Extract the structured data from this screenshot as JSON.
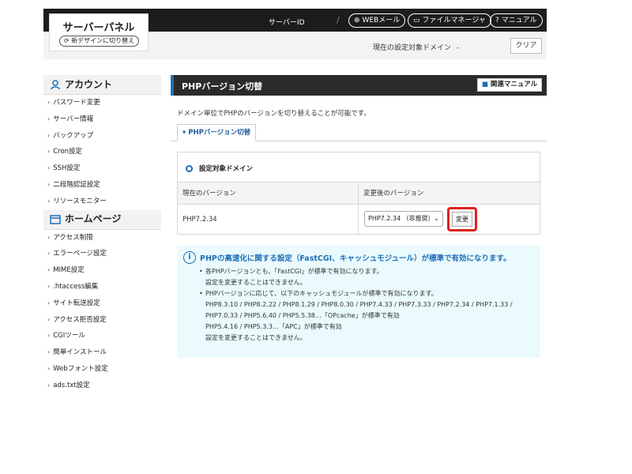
{
  "header": {
    "logo_title": "サーバーパネル",
    "new_design_label": "新デザインに切り替え",
    "server_id_label": "サーバーID",
    "separator": "/",
    "links": [
      {
        "icon": "globe-icon",
        "label": "WEBメール"
      },
      {
        "icon": "folder-icon",
        "label": "ファイルマネージャ"
      },
      {
        "icon": "question-icon",
        "label": "マニュアル"
      }
    ],
    "target_domain_label": "現在の設定対象ドメイン",
    "target_domain_value": "-",
    "clear_label": "クリア"
  },
  "sidebar": {
    "sections": [
      {
        "title": "アカウント",
        "icon": "user-icon",
        "items": [
          "パスワード変更",
          "サーバー情報",
          "バックアップ",
          "Cron設定",
          "SSH設定",
          "二段階認証設定",
          "リソースモニター"
        ]
      },
      {
        "title": "ホームページ",
        "icon": "window-icon",
        "items": [
          "アクセス制限",
          "エラーページ設定",
          "MIME設定",
          ".htaccess編集",
          "サイト転送設定",
          "アクセス拒否設定",
          "CGIツール",
          "簡単インストール",
          "Webフォント設定",
          "ads.txt設定"
        ]
      }
    ]
  },
  "main": {
    "title": "PHPバージョン切替",
    "manual_label": "関連マニュアル",
    "description": "ドメイン単位でPHPのバージョンを切り替えることが可能です。",
    "tab_label": "PHPバージョン切替",
    "panel_title": "設定対象ドメイン",
    "table": {
      "headers": [
        "現在のバージョン",
        "変更後のバージョン"
      ],
      "current_version": "PHP7.2.34",
      "selected_version": "PHP7.2.34 （非推奨）",
      "change_label": "変更"
    },
    "info": {
      "title": "PHPの高速化に関する設定（FastCGI、キャッシュモジュール）が標準で有効になります。",
      "lines": [
        {
          "bullet": "•",
          "text": "各PHPバージョンとも、「FastCGI」が標準で有効になります。"
        },
        {
          "bullet": "",
          "text": "設定を変更することはできません。"
        },
        {
          "bullet": "•",
          "text": "PHPバージョンに応じて、以下のキャッシュモジュールが標準で有効になります。"
        },
        {
          "bullet": "",
          "text": "PHP8.3.10 / PHP8.2.22 / PHP8.1.29 / PHP8.0.30 / PHP7.4.33 / PHP7.3.33 / PHP7.2.34 / PHP7.1.33 /"
        },
        {
          "bullet": "",
          "text": "PHP7.0.33 / PHP5.6.40 / PHP5.5.38…「OPcache」が標準で有効"
        },
        {
          "bullet": "",
          "text": "PHP5.4.16 / PHP5.3.3…「APC」が標準で有効"
        },
        {
          "bullet": "",
          "text": "設定を変更することはできません。"
        }
      ]
    }
  },
  "colors": {
    "accent": "#1e6fb8",
    "header_bg": "#1c1c1c",
    "highlight": "#e0201c",
    "info_bg": "#eafafd"
  }
}
